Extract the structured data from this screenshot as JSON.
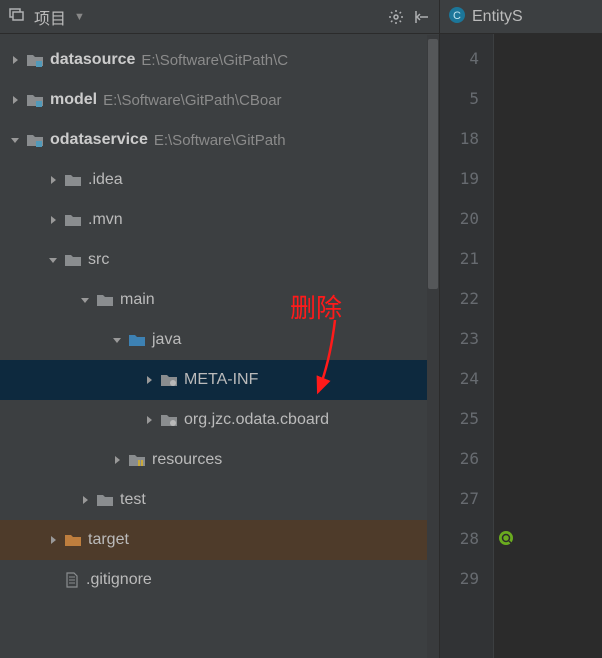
{
  "toolbar": {
    "title": "项目",
    "dropdown_icon": "▼"
  },
  "tree": [
    {
      "indent": 0,
      "arrow": "right",
      "folder": "module",
      "label": "datasource",
      "bold": true,
      "path": "E:\\Software\\GitPath\\C",
      "selected": false
    },
    {
      "indent": 0,
      "arrow": "right",
      "folder": "module",
      "label": "model",
      "bold": true,
      "path": "E:\\Software\\GitPath\\CBoar",
      "selected": false
    },
    {
      "indent": 0,
      "arrow": "down",
      "folder": "module",
      "label": "odataservice",
      "bold": true,
      "path": "E:\\Software\\GitPath",
      "selected": false
    },
    {
      "indent": 1,
      "arrow": "right",
      "folder": "gray",
      "label": ".idea",
      "bold": false,
      "selected": false
    },
    {
      "indent": 1,
      "arrow": "right",
      "folder": "gray",
      "label": ".mvn",
      "bold": false,
      "selected": false
    },
    {
      "indent": 1,
      "arrow": "down",
      "folder": "blue",
      "label": "src",
      "bold": false,
      "selected": false
    },
    {
      "indent": 2,
      "arrow": "down",
      "folder": "blue",
      "label": "main",
      "bold": false,
      "selected": false
    },
    {
      "indent": 3,
      "arrow": "down",
      "folder": "java-src",
      "label": "java",
      "bold": false,
      "selected": false
    },
    {
      "indent": 4,
      "arrow": "right",
      "folder": "package",
      "label": "META-INF",
      "bold": false,
      "selected": true
    },
    {
      "indent": 4,
      "arrow": "right",
      "folder": "package",
      "label": "org.jzc.odata.cboard",
      "bold": false,
      "selected": false
    },
    {
      "indent": 3,
      "arrow": "right",
      "folder": "resources",
      "label": "resources",
      "bold": false,
      "selected": false
    },
    {
      "indent": 2,
      "arrow": "right",
      "folder": "blue",
      "label": "test",
      "bold": false,
      "selected": false
    },
    {
      "indent": 1,
      "arrow": "right",
      "folder": "orange",
      "label": "target",
      "bold": false,
      "highlight": "orange"
    },
    {
      "indent": 1,
      "arrow": "none",
      "folder": "file",
      "label": ".gitignore",
      "bold": false
    }
  ],
  "editor": {
    "tab_label": "EntityS",
    "line_numbers": [
      "4",
      "5",
      "18",
      "19",
      "20",
      "21",
      "22",
      "23",
      "24",
      "25",
      "26",
      "27",
      "28",
      "29"
    ]
  },
  "annotation_text": "删除"
}
